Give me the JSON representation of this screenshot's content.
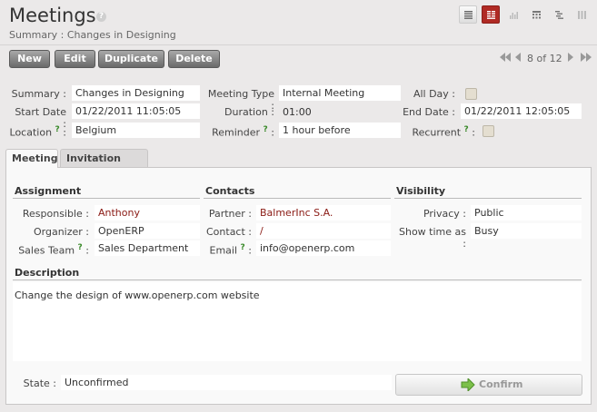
{
  "header": {
    "title": "Meetings",
    "help_glyph": "?",
    "breadcrumb": "Summary : Changes in Designing",
    "view_icons": [
      "list-view-icon",
      "form-view-icon",
      "graph-view-icon",
      "calendar-view-icon",
      "gantt-view-icon",
      "kanban-view-icon"
    ]
  },
  "toolbar": {
    "new_label": "New",
    "edit_label": "Edit",
    "duplicate_label": "Duplicate",
    "delete_label": "Delete",
    "pager_text": "8 of 12"
  },
  "fields": {
    "summary_label": "Summary :",
    "summary_value": "Changes in Designing",
    "start_date_label": "Start Date :",
    "start_date_value": "01/22/2011 11:05:05",
    "location_label": "Location",
    "location_value": "Belgium",
    "meeting_type_label": "Meeting Type :",
    "meeting_type_value": "Internal Meeting",
    "duration_label": "Duration :",
    "duration_value": "01:00",
    "reminder_label": "Reminder",
    "reminder_value": "1 hour before",
    "all_day_label": "All Day :",
    "end_date_label": "End Date :",
    "end_date_value": "01/22/2011 12:05:05",
    "recurrent_label": "Recurrent",
    "help_mark": "?",
    "colon": ":"
  },
  "tabs": [
    {
      "label": "Meeting"
    },
    {
      "label": "Invitation Detail"
    }
  ],
  "assignment": {
    "heading": "Assignment",
    "responsible_label": "Responsible :",
    "responsible_value": "Anthony",
    "organizer_label": "Organizer :",
    "organizer_value": "OpenERP",
    "sales_team_label": "Sales Team",
    "sales_team_value": "Sales Department"
  },
  "contacts": {
    "heading": "Contacts",
    "partner_label": "Partner :",
    "partner_value": "BalmerInc S.A.",
    "contact_label": "Contact :",
    "contact_value": "/",
    "email_label": "Email",
    "email_value": "info@openerp.com"
  },
  "visibility": {
    "heading": "Visibility",
    "privacy_label": "Privacy :",
    "privacy_value": "Public",
    "show_time_label": "Show time as :",
    "show_time_value": "Busy"
  },
  "description": {
    "heading": "Description",
    "text": "Change the design of www.openerp.com website"
  },
  "footer": {
    "state_label": "State :",
    "state_value": "Unconfirmed",
    "confirm_label": "Confirm"
  },
  "colors": {
    "accent": "#b02a24",
    "link": "#8a1a14",
    "help": "#3a8a2a"
  }
}
